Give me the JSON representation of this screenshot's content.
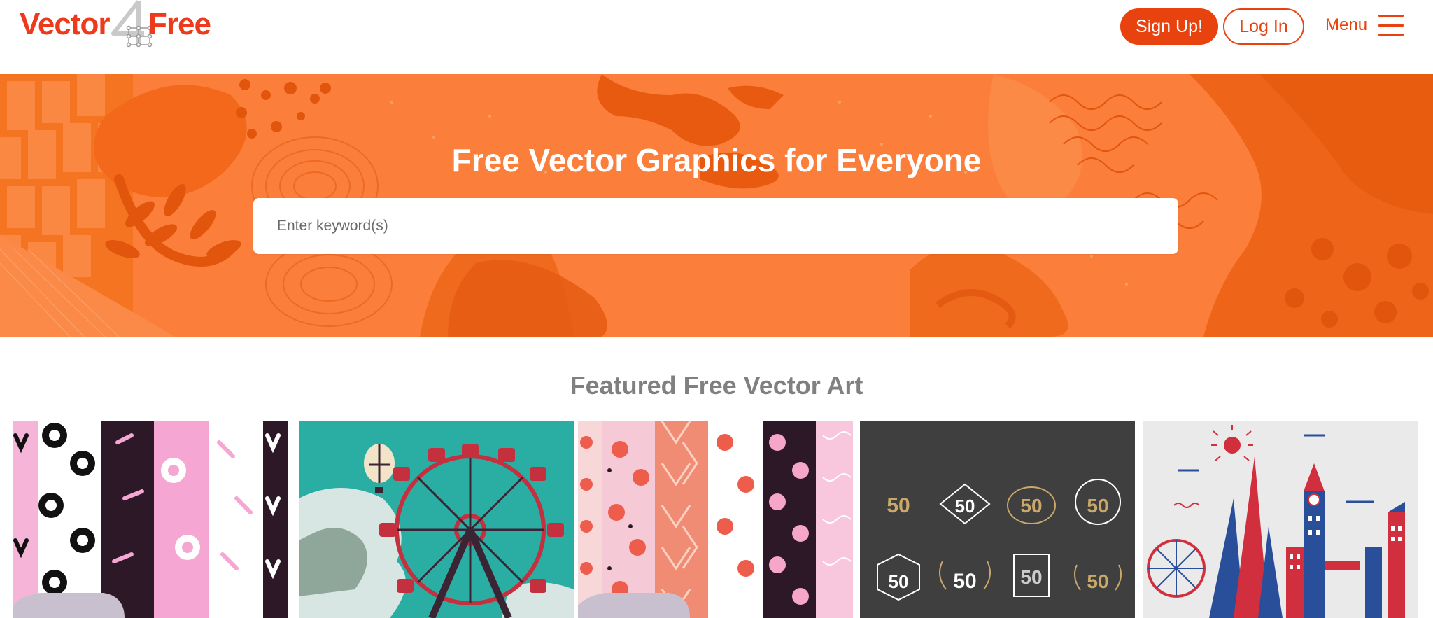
{
  "header": {
    "logo": {
      "word1": "Vector",
      "word2": "Free",
      "alt": "Vector4Free"
    },
    "signup_label": "Sign Up!",
    "login_label": "Log In",
    "menu_label": "Menu",
    "menu_icon": "hamburger-icon"
  },
  "hero": {
    "title": "Free Vector Graphics for Everyone",
    "search_placeholder": "Enter keyword(s)",
    "search_value": ""
  },
  "featured": {
    "title": "Featured Free Vector Art",
    "cards": [
      {
        "name": "card-patterns-brush-strokes"
      },
      {
        "name": "card-ferris-wheel"
      },
      {
        "name": "card-floral-patterns"
      },
      {
        "name": "card-anniversary-badges"
      },
      {
        "name": "card-london-skyline"
      }
    ]
  },
  "colors": {
    "brand": "#e8420f",
    "hero_bg": "#fb7f3b",
    "muted_heading": "#808080"
  }
}
